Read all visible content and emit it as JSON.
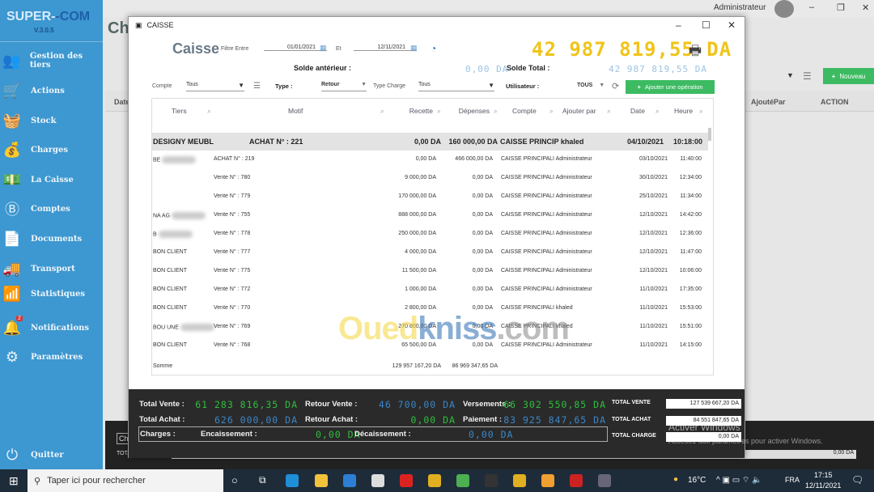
{
  "sidebar": {
    "brand_a": "SUPER-",
    "brand_b": "-COM",
    "version": "V.3.0.5",
    "items": [
      {
        "label": "Gestion des tiers",
        "icon": "users-icon"
      },
      {
        "label": "Actions",
        "icon": "cart-icon"
      },
      {
        "label": "Stock",
        "icon": "basket-icon"
      },
      {
        "label": "Charges",
        "icon": "money-bag-icon"
      },
      {
        "label": "La Caisse",
        "icon": "cash-register-icon"
      },
      {
        "label": "Comptes",
        "icon": "bitcoin-icon"
      },
      {
        "label": "Documents",
        "icon": "document-icon"
      },
      {
        "label": "Transport",
        "icon": "truck-icon"
      },
      {
        "label": "Statistiques",
        "icon": "chart-icon"
      },
      {
        "label": "Notifications",
        "icon": "bell-icon",
        "badge": "2"
      },
      {
        "label": "Paramètres",
        "icon": "gears-icon"
      }
    ],
    "quit": "Quitter"
  },
  "background_app": {
    "title": "Cha",
    "user": "Administrateur",
    "new_button": "Nouveau",
    "columns": {
      "date": "Date",
      "added_by": "AjoutéPar",
      "action": "ACTION"
    },
    "total_charge_label": "TOTAL CHARGE",
    "total_charge_value": "0,00 DA",
    "tab": "Ch"
  },
  "modal": {
    "window_title": "CAISSE",
    "heading": "Caisse",
    "filter_label": "Filtre Entre",
    "date_from": "01/01/2021",
    "and_label": "Et",
    "date_to": "12/11/2021",
    "big_total": "42 987 819,55 DA",
    "solde_anterieur_label": "Solde antérieur :",
    "solde_anterieur": "0,00 DA",
    "solde_total_label": "Solde Total :",
    "solde_total": "42 987 819,55 DA",
    "filters": {
      "compte_label": "Compte",
      "compte": "Tous",
      "type_label": "Type :",
      "type": "Retour",
      "type_charge_label": "Type Charge",
      "type_charge": "Tous",
      "utilisateur_label": "Utilisateur :",
      "utilisateur": "TOUS"
    },
    "add_button": "Ajouter une opération",
    "columns": [
      "Tiers",
      "Motif",
      "Recette",
      "Dépenses",
      "Compte",
      "Ajouter par",
      "Date",
      "Heure"
    ],
    "rows": [
      {
        "tiers": "DESIGNY MEUBL",
        "motif": "ACHAT N° : 221",
        "recette": "0,00 DA",
        "depenses": "160 000,00 DA",
        "compte": "CAISSE PRINCIP",
        "par": "khaled",
        "date": "04/10/2021",
        "heure": "10:18:00"
      },
      {
        "tiers": "BE",
        "motif": "ACHAT N° : 219",
        "recette": "0,00 DA",
        "depenses": "466 000,00 DA",
        "compte": "CAISSE PRINCIPALI",
        "par": "Administrateur",
        "date": "03/10/2021",
        "heure": "11:40:00"
      },
      {
        "tiers": "",
        "motif": "Vente N° : 780",
        "recette": "9 000,00 DA",
        "depenses": "0,00 DA",
        "compte": "CAISSE PRINCIPALI",
        "par": "Administrateur",
        "date": "30/10/2021",
        "heure": "12:34:00"
      },
      {
        "tiers": "",
        "motif": "Vente N° : 779",
        "recette": "170 000,00 DA",
        "depenses": "0,00 DA",
        "compte": "CAISSE PRINCIPALI",
        "par": "Administrateur",
        "date": "25/10/2021",
        "heure": "11:34:00"
      },
      {
        "tiers": "NA            AG",
        "motif": "Vente N° : 755",
        "recette": "888 000,00 DA",
        "depenses": "0,00 DA",
        "compte": "CAISSE PRINCIPALI",
        "par": "Administrateur",
        "date": "12/10/2021",
        "heure": "14:42:00"
      },
      {
        "tiers": "B",
        "motif": "Vente N° : 778",
        "recette": "250 000,00 DA",
        "depenses": "0,00 DA",
        "compte": "CAISSE PRINCIPALI",
        "par": "Administrateur",
        "date": "12/10/2021",
        "heure": "12:36:00"
      },
      {
        "tiers": "BON CLIENT",
        "motif": "Vente N° : 777",
        "recette": "4 000,00 DA",
        "depenses": "0,00 DA",
        "compte": "CAISSE PRINCIPALI",
        "par": "Administrateur",
        "date": "12/10/2021",
        "heure": "11:47:00"
      },
      {
        "tiers": "BON CLIENT",
        "motif": "Vente N° : 775",
        "recette": "11 500,00 DA",
        "depenses": "0,00 DA",
        "compte": "CAISSE PRINCIPALI",
        "par": "Administrateur",
        "date": "12/10/2021",
        "heure": "10:06:00"
      },
      {
        "tiers": "BON CLIENT",
        "motif": "Vente N° : 772",
        "recette": "1 000,00 DA",
        "depenses": "0,00 DA",
        "compte": "CAISSE PRINCIPALI",
        "par": "Administrateur",
        "date": "11/10/2021",
        "heure": "17:35:00"
      },
      {
        "tiers": "BON CLIENT",
        "motif": "Vente N° : 770",
        "recette": "2 800,00 DA",
        "depenses": "0,00 DA",
        "compte": "CAISSE PRINCIPALI",
        "par": "khaled",
        "date": "11/10/2021",
        "heure": "15:53:00"
      },
      {
        "tiers": "BOU        UNE",
        "motif": "Vente N° : 769",
        "recette": "270 800,00 DA",
        "depenses": "0,00 DA",
        "compte": "CAISSE PRINCIPALI",
        "par": "khaled",
        "date": "11/10/2021",
        "heure": "15:51:00"
      },
      {
        "tiers": "BON CLIENT",
        "motif": "Vente N° : 768",
        "recette": "65 500,00 DA",
        "depenses": "0,00 DA",
        "compte": "CAISSE PRINCIPALI",
        "par": "Administrateur",
        "date": "11/10/2021",
        "heure": "14:15:00"
      }
    ],
    "sum_label": "Somme",
    "sum_recette": "129 957 167,20 DA",
    "sum_depenses": "86 969 347,65 DA",
    "watermark_a": "Oued",
    "watermark_b": "kniss",
    "watermark_c": ".com",
    "summary": {
      "total_vente_label": "Total Vente :",
      "total_vente": "61 283 816,35 DA",
      "retour_vente_label": "Retour Vente :",
      "retour_vente": "46 700,00 DA",
      "versements_label": "Versements :",
      "versements": "66 302 550,85 DA",
      "total_achat_label": "Total Achat :",
      "total_achat": "626 000,00 DA",
      "retour_achat_label": "Retour Achat :",
      "retour_achat": "0,00 DA",
      "paiement_label": "Paiement :",
      "paiement": "83 925 847,65 DA",
      "charges_label": "Charges :",
      "encaissement_label": "Encaissement :",
      "encaissement": "0,00 DA",
      "decaissement_label": "Décaissement :",
      "decaissement": "0,00 DA",
      "tv_label": "TOTAL VENTE",
      "tv": "127 539 667,20 DA",
      "ta_label": "TOTAL ACHAT",
      "ta": "84 551 847,65 DA",
      "tc_label": "TOTAL CHARGE",
      "tc": "0,00 DA"
    }
  },
  "windows_activation": {
    "title": "Activer Windows",
    "subtitle": "Accédez aux paramètres pour activer Windows."
  },
  "taskbar": {
    "search_placeholder": "Taper ici pour rechercher",
    "weather": "16°C",
    "lang": "FRA",
    "time": "17:15",
    "date": "12/11/2021"
  },
  "colors": {
    "sidebar": "#3d97d0",
    "green_button": "#3dbb62",
    "lcd_yellow": "#f0c419",
    "lcd_green": "#2fbf3c",
    "lcd_blue": "#3a86c8"
  }
}
